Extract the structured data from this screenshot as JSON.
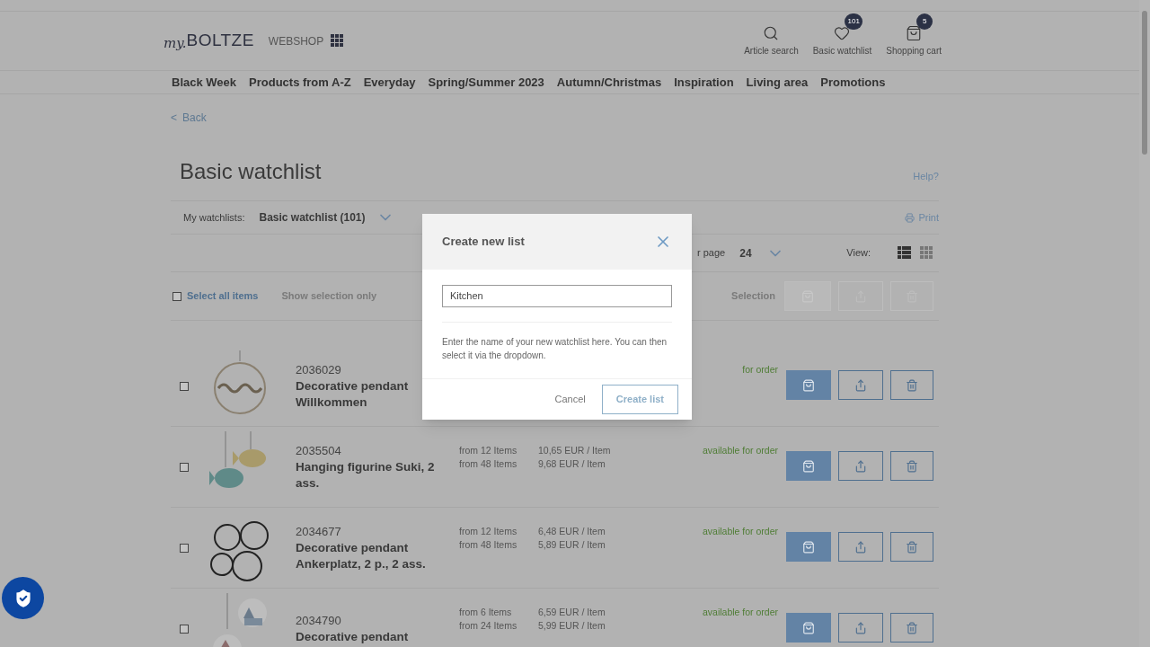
{
  "header": {
    "logo_prefix": "my.",
    "logo_name": "BOLTZE",
    "shop_label": "WEBSHOP",
    "actions": [
      {
        "kind": "search",
        "label": "Article search"
      },
      {
        "kind": "watchlist",
        "label": "Basic watchlist",
        "badge": "101"
      },
      {
        "kind": "cart",
        "label": "Shopping cart",
        "badge": "5"
      }
    ]
  },
  "nav": [
    "Black Week",
    "Products from A-Z",
    "Everyday",
    "Spring/Summer 2023",
    "Autumn/Christmas",
    "Inspiration",
    "Living area",
    "Promotions"
  ],
  "back": {
    "arrow": "<",
    "label": "Back"
  },
  "title": "Basic watchlist",
  "help": "Help?",
  "watchlists": {
    "label": "My watchlists:",
    "current": "Basic watchlist (101)",
    "print": "Print"
  },
  "paging": {
    "per_page_label": "r page",
    "per_page": "24",
    "view_label": "View:",
    "views": [
      {
        "kind": "list",
        "selected": true
      },
      {
        "kind": "grid",
        "selected": false
      }
    ]
  },
  "selection_bar": {
    "select_all": "Select all items",
    "checked": false,
    "show_selection": "Show selection only",
    "selection_label": "Selection"
  },
  "items": [
    {
      "number": "2036029",
      "name": "Decorative pendant Willkommen",
      "checked": false,
      "availability": "for order"
    },
    {
      "number": "2035504",
      "name": "Hanging figurine Suki, 2 ass.",
      "checked": false,
      "prices": [
        {
          "qty": "from 12 Items",
          "price": "10,65 EUR / Item"
        },
        {
          "qty": "from 48 Items",
          "price": "9,68 EUR / Item"
        }
      ],
      "availability": "available for order"
    },
    {
      "number": "2034677",
      "name": "Decorative pendant Ankerplatz, 2 p., 2 ass.",
      "checked": false,
      "prices": [
        {
          "qty": "from 12 Items",
          "price": "6,48 EUR / Item"
        },
        {
          "qty": "from 48 Items",
          "price": "5,89 EUR / Item"
        }
      ],
      "availability": "available for order"
    },
    {
      "number": "2034790",
      "name": "Decorative pendant",
      "checked": false,
      "prices": [
        {
          "qty": "from 6 Items",
          "price": "6,59 EUR / Item"
        },
        {
          "qty": "from 24 Items",
          "price": "5,99 EUR / Item"
        }
      ],
      "availability": "available for order"
    }
  ],
  "modal": {
    "title": "Create new list",
    "value": "Kitchen",
    "hint": "Enter the name of your new watchlist here. You can then select it via the dropdown.",
    "cancel": "Cancel",
    "submit": "Create list"
  }
}
